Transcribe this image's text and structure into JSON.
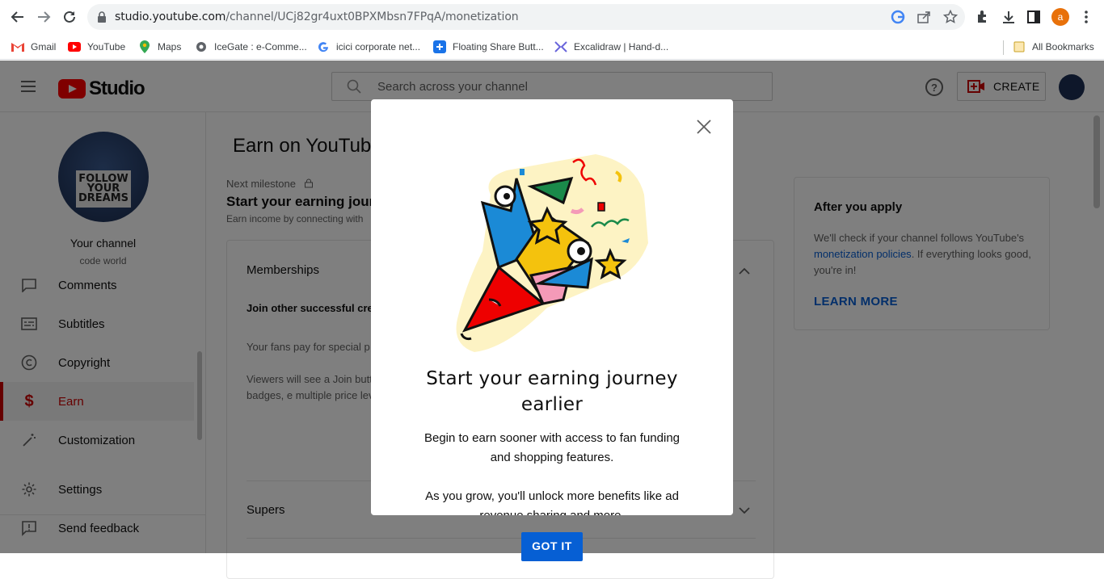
{
  "browser": {
    "url_host": "studio.youtube.com",
    "url_path": "/channel/UCj82gr4uxt0BPXMbsn7FPqA/monetization",
    "profile_initial": "a",
    "bookmarks": [
      {
        "label": "Gmail",
        "icon": "gmail-icon"
      },
      {
        "label": "YouTube",
        "icon": "youtube-icon"
      },
      {
        "label": "Maps",
        "icon": "maps-icon"
      },
      {
        "label": "IceGate : e-Comme...",
        "icon": "icegate-icon"
      },
      {
        "label": "icici corporate net...",
        "icon": "google-icon"
      },
      {
        "label": "Floating Share Butt...",
        "icon": "plus-icon"
      },
      {
        "label": "Excalidraw | Hand-d...",
        "icon": "excalidraw-icon"
      }
    ],
    "all_bookmarks": "All Bookmarks"
  },
  "header": {
    "logo_text": "Studio",
    "search_placeholder": "Search across your channel",
    "create_label": "CREATE"
  },
  "sidebar": {
    "your_channel": "Your channel",
    "channel_name": "code world",
    "avatar_text": [
      "FOLLOW",
      "YOUR",
      "DREAMS"
    ],
    "items": [
      {
        "label": "Comments",
        "icon": "comments-icon"
      },
      {
        "label": "Subtitles",
        "icon": "subtitles-icon"
      },
      {
        "label": "Copyright",
        "icon": "copyright-icon"
      },
      {
        "label": "Earn",
        "icon": "dollar-icon",
        "active": true
      },
      {
        "label": "Customization",
        "icon": "magic-wand-icon"
      },
      {
        "label": "Settings",
        "icon": "gear-icon"
      },
      {
        "label": "Send feedback",
        "icon": "feedback-icon"
      }
    ]
  },
  "main": {
    "title": "Earn on YouTube",
    "milestone_label": "Next milestone",
    "milestone_title": "Start your earning jour",
    "milestone_sub": "Earn income by connecting with",
    "memberships_title": "Memberships",
    "memberships_bold": "Join other successful crea memberships",
    "memberships_p1": "Your fans pay for special p",
    "memberships_p2": "Viewers will see a Join butt your fans special badges, e multiple price levels. You re",
    "supers_title": "Supers"
  },
  "aside": {
    "title": "After you apply",
    "text_before": "We'll check if your channel follows YouTube's ",
    "link": "monetization policies",
    "text_after": ". If everything looks good, you're in!",
    "learn_more": "LEARN MORE"
  },
  "modal": {
    "title": "Start your earning journey earlier",
    "p1": "Begin to earn sooner with access to fan funding and shopping features.",
    "p2": "As you grow, you'll unlock more benefits like ad revenue sharing and more.",
    "button": "GOT IT"
  },
  "colors": {
    "brand_red": "#ff0000",
    "active_red": "#cc0000",
    "link_blue": "#065fd4"
  }
}
